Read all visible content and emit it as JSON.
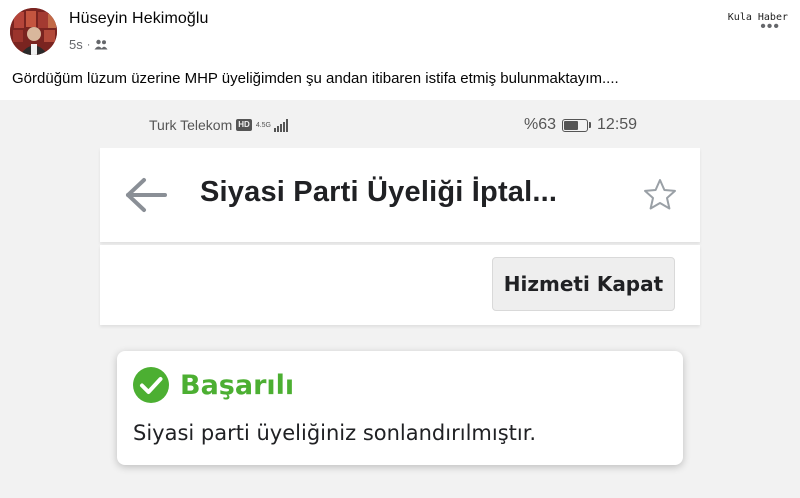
{
  "post": {
    "author": "Hüseyin Hekimoğlu",
    "time": "5s",
    "separator": "·",
    "privacy_icon": "friends-icon",
    "text": "Gördüğüm lüzum üzerine MHP üyeliğimden şu andan itibaren istifa etmiş bulunmaktayım....",
    "more_icon": "•••"
  },
  "watermark": "Kula Haber",
  "status_bar": {
    "carrier": "Turk Telekom",
    "hd_badge": "HD",
    "network": "4.5G",
    "battery_percent": "%63",
    "battery_level": 0.63,
    "time": "12:59"
  },
  "app_bar": {
    "back_icon": "arrow-left-icon",
    "title": "Siyasi Parti Üyeliği İptal...",
    "star_icon": "star-outline-icon"
  },
  "toolbar": {
    "close_service_label": "Hizmeti Kapat"
  },
  "success_card": {
    "icon": "check-circle-icon",
    "title": "Başarılı",
    "message": "Siyasi parti üyeliğiniz sonlandırılmıştır."
  },
  "colors": {
    "success": "#4caf32",
    "text_dark": "#202124",
    "muted": "#65676b",
    "screen_bg": "#f2f2f2"
  }
}
